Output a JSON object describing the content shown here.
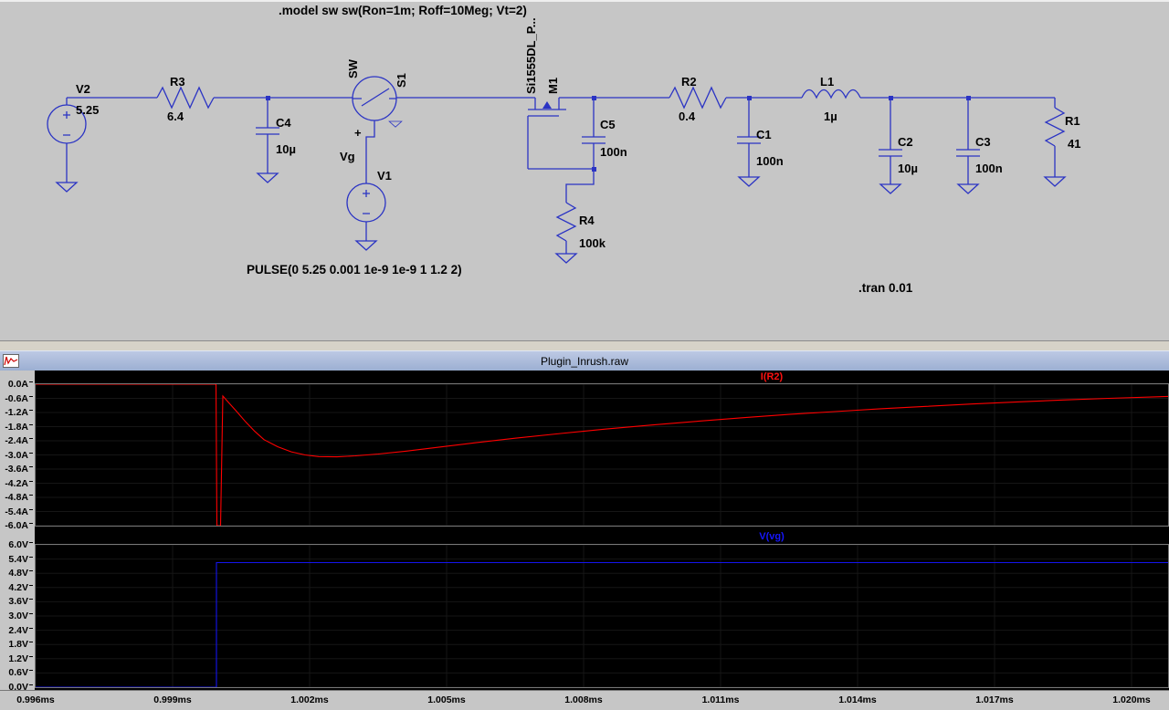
{
  "window": {
    "title": "Plugin_Inrush.raw"
  },
  "colors": {
    "wire": "#2b34c4",
    "trace_current": "#ff0000",
    "trace_voltage": "#1414ee",
    "plot_background": "#000000",
    "schematic_background": "#c6c6c6"
  },
  "schematic": {
    "directive_model": ".model sw sw(Ron=1m; Roff=10Meg; Vt=2)",
    "directive_pulse": "PULSE(0 5.25 0.001 1e-9 1e-9 1 1.2 2)",
    "directive_tran": ".tran 0.01",
    "labels": {
      "v2": "V2",
      "v2_val": "5.25",
      "r3": "R3",
      "r3_val": "6.4",
      "c4": "C4",
      "c4_val": "10µ",
      "sw": "SW",
      "s1": "S1",
      "plus": "+",
      "vg": "Vg",
      "v1": "V1",
      "mosfet_model": "Si1555DL_P...",
      "m1": "M1",
      "c5": "C5",
      "c5_val": "100n",
      "r4": "R4",
      "r4_val": "100k",
      "r2": "R2",
      "r2_val": "0.4",
      "c1": "C1",
      "c1_val": "100n",
      "l1": "L1",
      "l1_val": "1µ",
      "c2": "C2",
      "c2_val": "10µ",
      "c3": "C3",
      "c3_val": "100n",
      "r1": "R1",
      "r1_val": "41"
    }
  },
  "chart_data": [
    {
      "type": "line",
      "title": "I(R2)",
      "legend_position": "top-center",
      "grid": true,
      "ylim": [
        -6.0,
        0.0
      ],
      "yticks": [
        "0.0A",
        "-0.6A",
        "-1.2A",
        "-1.8A",
        "-2.4A",
        "-3.0A",
        "-3.6A",
        "-4.2A",
        "-4.8A",
        "-5.4A",
        "-6.0A"
      ],
      "xlim_ms": [
        0.996,
        1.0208
      ],
      "xticks": [
        "0.996ms",
        "0.999ms",
        "1.002ms",
        "1.005ms",
        "1.008ms",
        "1.011ms",
        "1.014ms",
        "1.017ms",
        "1.020ms"
      ],
      "series": [
        {
          "name": "I(R2)",
          "color": "#ff0000",
          "points": [
            [
              0.996,
              0
            ],
            [
              0.99995,
              0
            ],
            [
              0.99997,
              -6
            ],
            [
              1.00005,
              -6
            ],
            [
              1.0001,
              -0.5
            ],
            [
              1.0002,
              -0.72
            ],
            [
              1.0004,
              -1.15
            ],
            [
              1.0006,
              -1.6
            ],
            [
              1.0008,
              -2.0
            ],
            [
              1.001,
              -2.35
            ],
            [
              1.0013,
              -2.65
            ],
            [
              1.0016,
              -2.87
            ],
            [
              1.0019,
              -3.0
            ],
            [
              1.0022,
              -3.07
            ],
            [
              1.0026,
              -3.08
            ],
            [
              1.003,
              -3.04
            ],
            [
              1.0035,
              -2.96
            ],
            [
              1.0041,
              -2.84
            ],
            [
              1.0048,
              -2.68
            ],
            [
              1.0056,
              -2.49
            ],
            [
              1.0065,
              -2.29
            ],
            [
              1.0075,
              -2.09
            ],
            [
              1.0085,
              -1.9
            ],
            [
              1.0095,
              -1.73
            ],
            [
              1.0105,
              -1.57
            ],
            [
              1.0115,
              -1.42
            ],
            [
              1.0125,
              -1.28
            ],
            [
              1.0135,
              -1.16
            ],
            [
              1.0145,
              -1.04
            ],
            [
              1.0155,
              -0.94
            ],
            [
              1.0165,
              -0.84
            ],
            [
              1.0175,
              -0.75
            ],
            [
              1.0185,
              -0.67
            ],
            [
              1.0195,
              -0.6
            ],
            [
              1.0208,
              -0.52
            ]
          ]
        }
      ]
    },
    {
      "type": "line",
      "title": "V(vg)",
      "legend_position": "top-center",
      "grid": true,
      "ylim": [
        0.0,
        6.0
      ],
      "yticks": [
        "6.0V",
        "5.4V",
        "4.8V",
        "4.2V",
        "3.6V",
        "3.0V",
        "2.4V",
        "1.8V",
        "1.2V",
        "0.6V",
        "0.0V"
      ],
      "xlim_ms": [
        0.996,
        1.0208
      ],
      "xticks": [
        "0.996ms",
        "0.999ms",
        "1.002ms",
        "1.005ms",
        "1.008ms",
        "1.011ms",
        "1.014ms",
        "1.017ms",
        "1.020ms"
      ],
      "series": [
        {
          "name": "V(vg)",
          "color": "#1414ee",
          "points": [
            [
              0.996,
              0
            ],
            [
              0.99996,
              0
            ],
            [
              0.99996,
              5.25
            ],
            [
              1.0208,
              5.25
            ]
          ]
        }
      ]
    }
  ]
}
